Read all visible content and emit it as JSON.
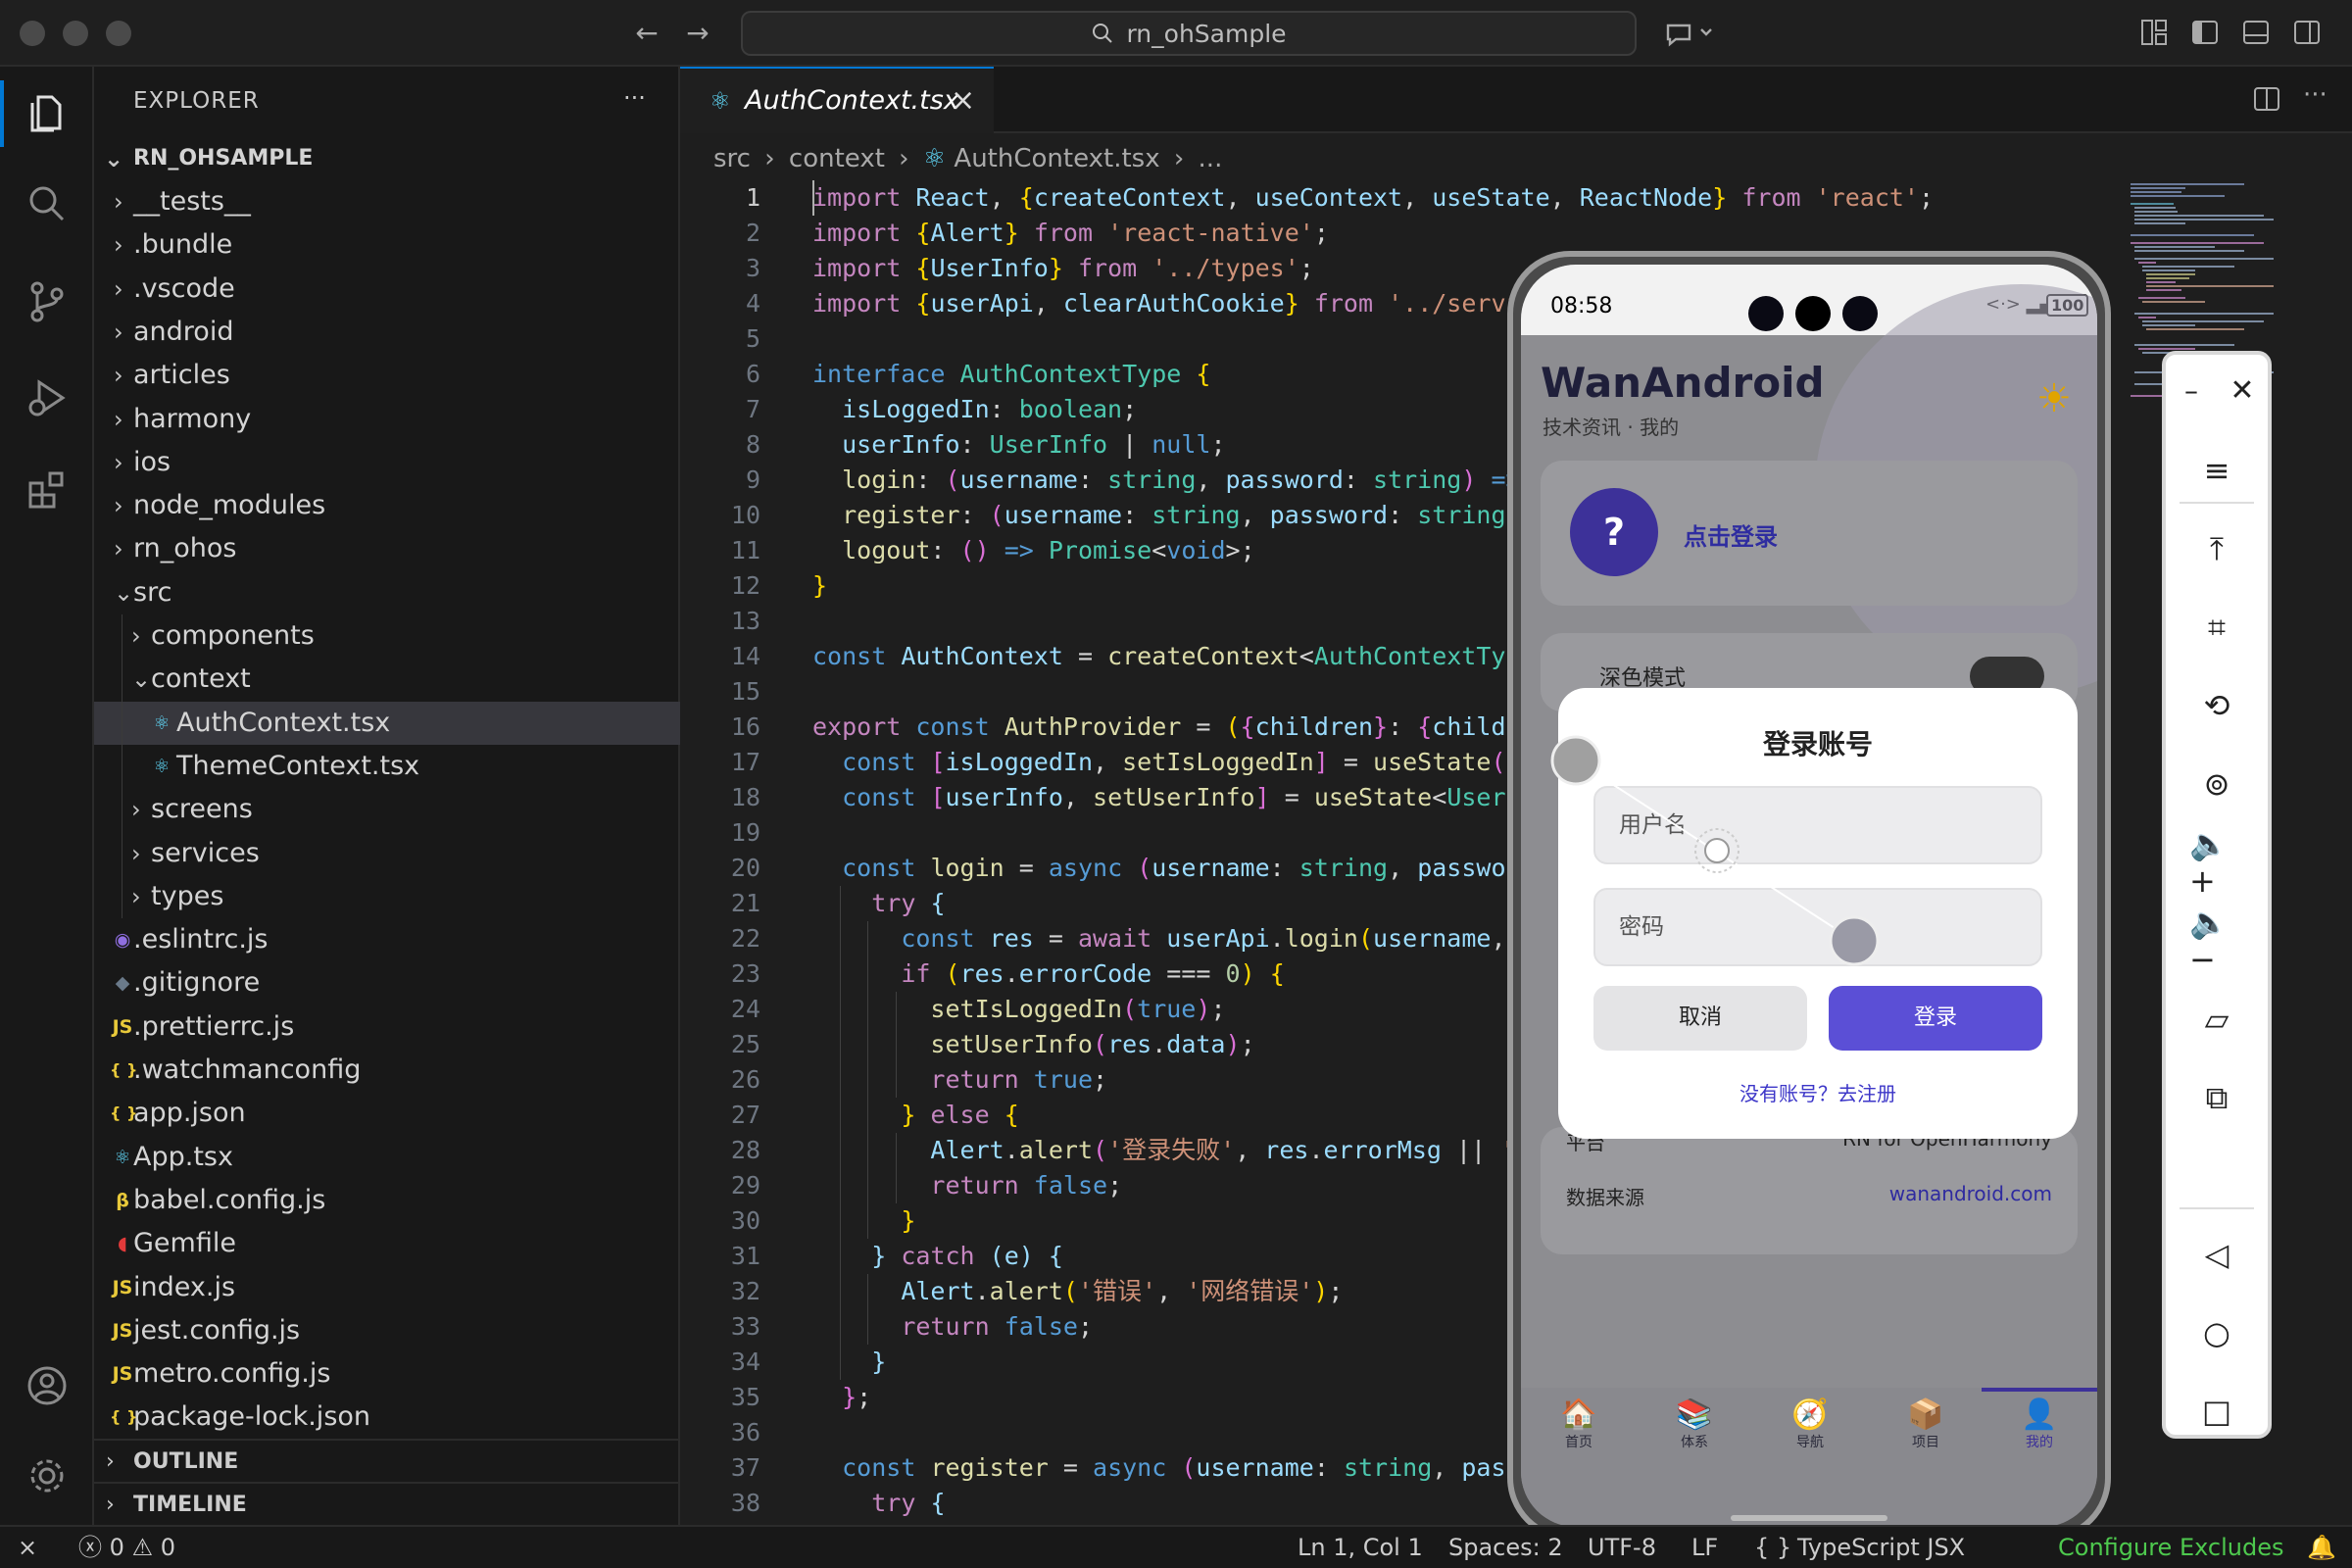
{
  "window": {
    "search_text": "rn_ohSample"
  },
  "explorer": {
    "title": "EXPLORER",
    "more": "···",
    "root": "RN_OHSAMPLE",
    "items": [
      {
        "label": "__tests__",
        "icon": "folder-closed"
      },
      {
        "label": ".bundle",
        "icon": "folder-closed"
      },
      {
        "label": ".vscode",
        "icon": "folder-closed"
      },
      {
        "label": "android",
        "icon": "folder-closed"
      },
      {
        "label": "articles",
        "icon": "folder-closed"
      },
      {
        "label": "harmony",
        "icon": "folder-closed"
      },
      {
        "label": "ios",
        "icon": "folder-closed"
      },
      {
        "label": "node_modules",
        "icon": "folder-closed"
      },
      {
        "label": "rn_ohos",
        "icon": "folder-closed"
      },
      {
        "label": "src",
        "icon": "folder-open"
      },
      {
        "label": "components",
        "icon": "folder-closed"
      },
      {
        "label": "context",
        "icon": "folder-open"
      },
      {
        "label": "AuthContext.tsx",
        "icon": "react-icon"
      },
      {
        "label": "ThemeContext.tsx",
        "icon": "react-icon"
      },
      {
        "label": "screens",
        "icon": "folder-closed"
      },
      {
        "label": "services",
        "icon": "folder-closed"
      },
      {
        "label": "types",
        "icon": "folder-closed"
      },
      {
        "label": ".eslintrc.js",
        "icon": "eslint-icon"
      },
      {
        "label": ".gitignore",
        "icon": "git-icon"
      },
      {
        "label": ".prettierrc.js",
        "icon": "js-icon"
      },
      {
        "label": ".watchmanconfig",
        "icon": "json-icon"
      },
      {
        "label": "app.json",
        "icon": "json-icon"
      },
      {
        "label": "App.tsx",
        "icon": "react-icon"
      },
      {
        "label": "babel.config.js",
        "icon": "babel-icon"
      },
      {
        "label": "Gemfile",
        "icon": "ruby-icon"
      },
      {
        "label": "index.js",
        "icon": "js-icon"
      },
      {
        "label": "jest.config.js",
        "icon": "js-icon"
      },
      {
        "label": "metro.config.js",
        "icon": "js-icon"
      },
      {
        "label": "package-lock.json",
        "icon": "json-icon"
      }
    ],
    "outline": "OUTLINE",
    "timeline": "TIMELINE"
  },
  "editor": {
    "tab_label": "AuthContext.tsx",
    "breadcrumb": [
      "src",
      "context",
      "AuthContext.tsx",
      "..."
    ],
    "line_numbers": [
      "1",
      "2",
      "3",
      "4",
      "5",
      "6",
      "7",
      "8",
      "9",
      "10",
      "11",
      "12",
      "13",
      "14",
      "15",
      "16",
      "17",
      "18",
      "19",
      "20",
      "21",
      "22",
      "23",
      "24",
      "25",
      "26",
      "27",
      "28",
      "29",
      "30",
      "31",
      "32",
      "33",
      "34",
      "35",
      "36",
      "37",
      "38"
    ]
  },
  "statusbar": {
    "errors": "0",
    "warnings": "0",
    "position": "Ln 1, Col 1",
    "spaces": "Spaces: 2",
    "encoding": "UTF-8",
    "eol": "LF",
    "language": "TypeScript JSX",
    "configure": "Configure Excludes"
  },
  "phone": {
    "time": "08:58",
    "battery": "100",
    "app_title": "WanAndroid",
    "app_subtitle": "技术资讯 · 我的",
    "avatar_text": "?",
    "login_prompt": "点击登录",
    "dark_mode_label": "深色模式",
    "dialog": {
      "title": "登录账号",
      "username_placeholder": "用户名",
      "password_placeholder": "密码",
      "cancel": "取消",
      "login": "登录",
      "register_link": "没有账号？去注册"
    },
    "info": [
      {
        "label": "平台",
        "value": "RN for OpenHarmony"
      },
      {
        "label": "数据来源",
        "value": "wanandroid.com"
      }
    ],
    "tabs": [
      "首页",
      "体系",
      "导航",
      "项目",
      "我的"
    ]
  },
  "colors": {
    "accent": "#5b4fd6",
    "vscode_blue": "#0078d4",
    "configure_green": "#4ec94e"
  }
}
